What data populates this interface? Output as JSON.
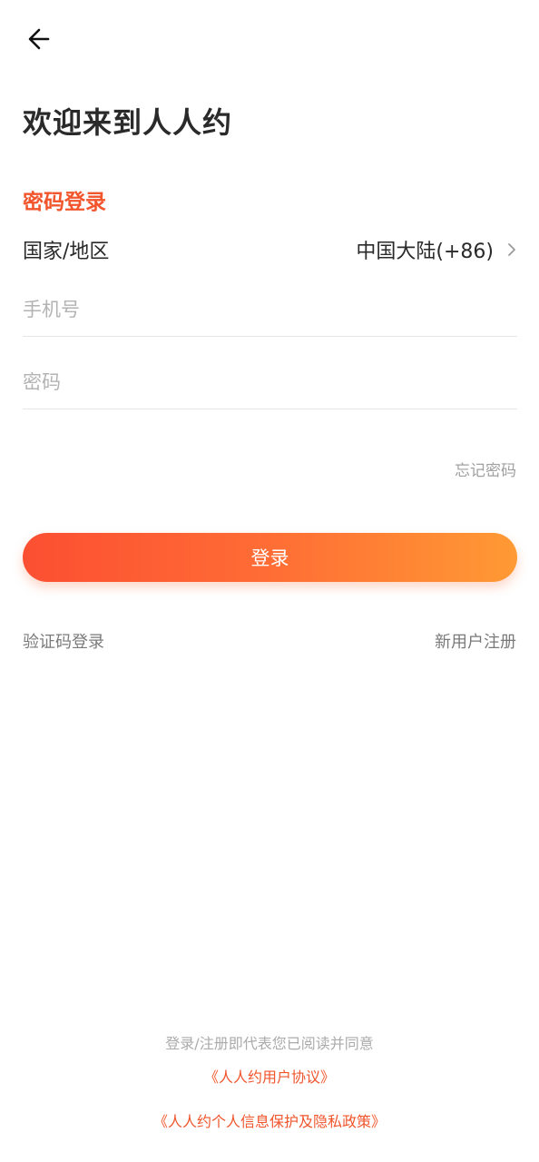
{
  "header": {
    "back_icon": "arrow-left-icon",
    "title": "欢迎来到人人约",
    "subtitle": "密码登录"
  },
  "form": {
    "region_label": "国家/地区",
    "region_value": "中国大陆(+86)",
    "region_chevron_icon": "chevron-right-icon",
    "phone_placeholder": "手机号",
    "phone_value": "",
    "password_placeholder": "密码",
    "password_value": "",
    "forgot_label": "忘记密码",
    "login_label": "登录"
  },
  "links": {
    "sms_login": "验证码登录",
    "register": "新用户注册"
  },
  "footer": {
    "notice": "登录/注册即代表您已阅读并同意",
    "agreement": "《人人约用户协议》",
    "privacy": "《人人约个人信息保护及隐私政策》"
  },
  "colors": {
    "accent": "#f2552c",
    "gradient_start": "#fc4f32",
    "gradient_end": "#ff9a34"
  }
}
